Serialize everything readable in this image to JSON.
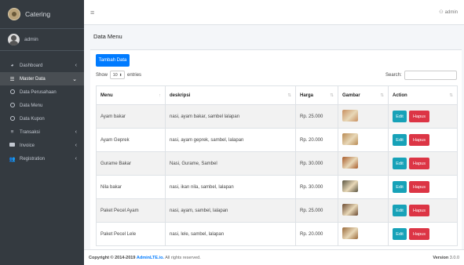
{
  "brand": {
    "name": "Catering"
  },
  "user": {
    "name": "admin"
  },
  "topbar": {
    "user_label": "admin"
  },
  "sidebar": {
    "items": [
      {
        "label": "Dashboard",
        "icon": "dashboard-icon",
        "has_children": true
      },
      {
        "label": "Master Data",
        "icon": "master-data-icon",
        "has_children": true,
        "active": true
      },
      {
        "label": "Data Perusahaan",
        "icon": "circle-icon",
        "sub": true
      },
      {
        "label": "Data Menu",
        "icon": "circle-icon",
        "sub": true
      },
      {
        "label": "Data Kupon",
        "icon": "circle-icon",
        "sub": true
      },
      {
        "label": "Transaksi",
        "icon": "list-icon",
        "has_children": true
      },
      {
        "label": "Invoice",
        "icon": "invoice-icon",
        "has_children": true
      },
      {
        "label": "Registration",
        "icon": "users-icon",
        "has_children": true
      }
    ]
  },
  "page": {
    "title": "Data Menu"
  },
  "toolbar": {
    "add_label": "Tambah Data",
    "show_label": "Show",
    "entries_value": "10",
    "entries_label": "entries",
    "search_label": "Search:"
  },
  "table": {
    "headers": [
      "Menu",
      "deskripsi",
      "Harga",
      "Gambar",
      "Action"
    ],
    "edit_label": "Edit",
    "delete_label": "Hapus",
    "rows": [
      {
        "menu": "Ayam bakar",
        "deskripsi": "nasi, ayam bakar, sambel lalapan",
        "harga": "Rp. 25.000",
        "img_color": "#c89060"
      },
      {
        "menu": "Ayam Geprek",
        "deskripsi": "nasi, ayam geprek, sambel, lalapan",
        "harga": "Rp. 20.000",
        "img_color": "#b88a52"
      },
      {
        "menu": "Gurame Bakar",
        "deskripsi": "Nasi, Gurame, Sambel",
        "harga": "Rp. 30.000",
        "img_color": "#a85b2a"
      },
      {
        "menu": "Nila bakar",
        "deskripsi": "nasi, ikan nila, sambel, lalapan",
        "harga": "Rp. 30.000",
        "img_color": "#5a5440"
      },
      {
        "menu": "Paket Pecel Ayam",
        "deskripsi": "nasi, ayam, sambel, lalapan",
        "harga": "Rp. 25.000",
        "img_color": "#6b4a30"
      },
      {
        "menu": "Paket Pecel Lele",
        "deskripsi": "nasi, lele, sambel, lalapan",
        "harga": "Rp. 20.000",
        "img_color": "#9a6a3a"
      }
    ]
  },
  "footer": {
    "copyright": "Copyright © 2014-2019",
    "brand": "AdminLTE.io.",
    "rights": "All rights reserved.",
    "version_label": "Version",
    "version": "3.0.0"
  },
  "colors": {
    "sidebar_bg": "#343a40",
    "primary": "#007bff",
    "info": "#17a2b8",
    "danger": "#dc3545"
  }
}
